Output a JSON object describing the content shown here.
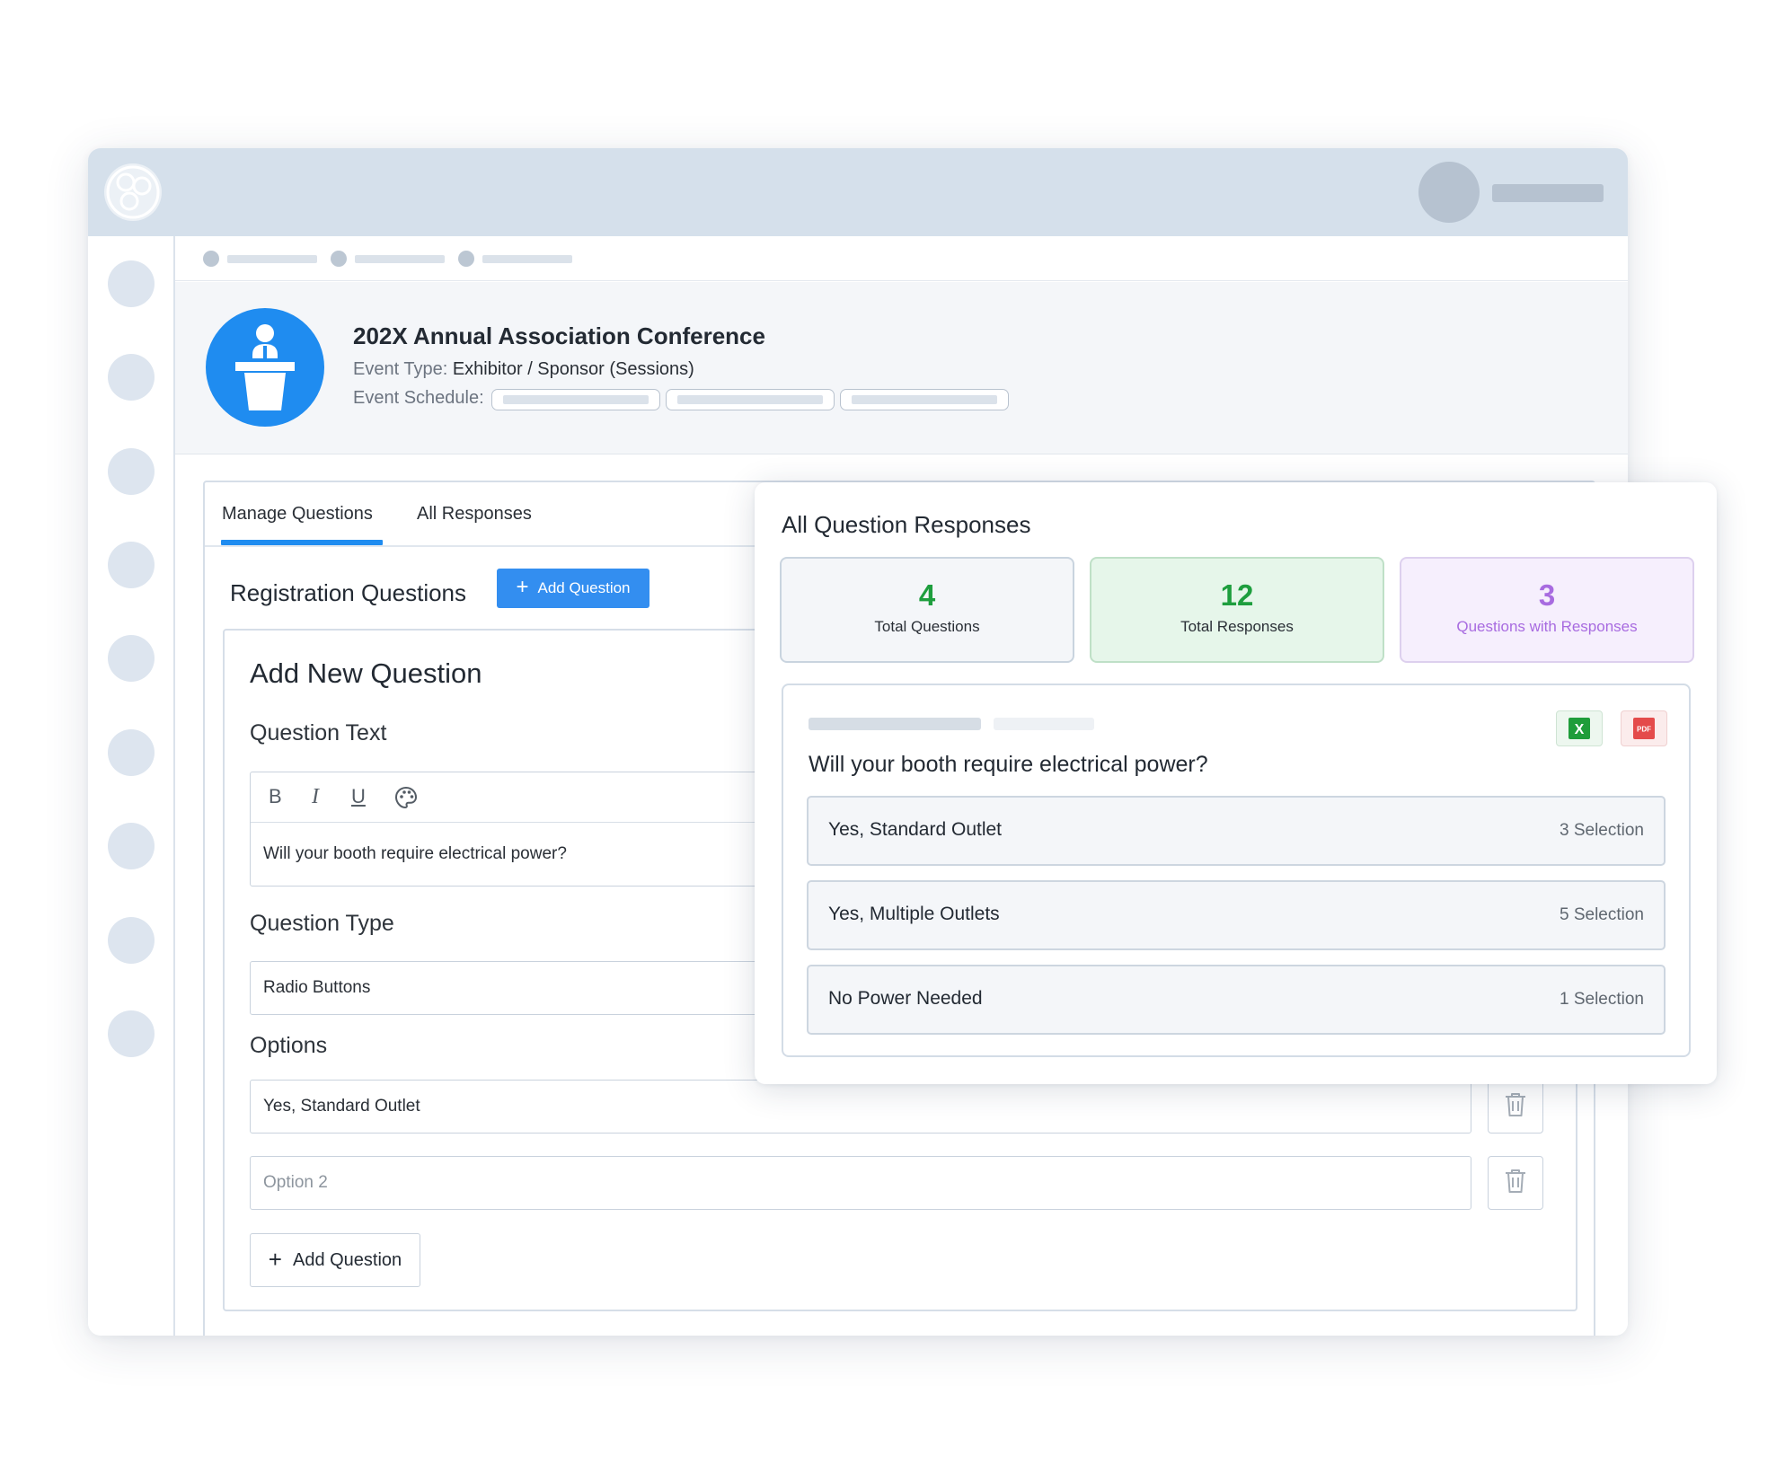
{
  "event": {
    "title": "202X Annual Association Conference",
    "type_label": "Event Type:",
    "type_value": "Exhibitor / Sponsor (Sessions)",
    "schedule_label": "Event Schedule:"
  },
  "tabs": [
    {
      "label": "Manage Questions",
      "active": true
    },
    {
      "label": "All Responses",
      "active": false
    }
  ],
  "registration": {
    "title": "Registration Questions",
    "add_button": "Add Question"
  },
  "form": {
    "heading": "Add New Question",
    "question_text_label": "Question Text",
    "toolbar": {
      "bold": "B",
      "italic": "I",
      "underline": "U"
    },
    "question_text_value": "Will your booth require electrical power?",
    "question_type_label": "Question Type",
    "question_type_value": "Radio Buttons",
    "options_label": "Options",
    "options": [
      {
        "value": "Yes, Standard Outlet",
        "placeholder": ""
      },
      {
        "value": "",
        "placeholder": "Option 2"
      }
    ],
    "add_button": "Add Question"
  },
  "responses": {
    "title": "All Question Responses",
    "stats": [
      {
        "number": "4",
        "label": "Total Questions",
        "color": "#1e9e3e"
      },
      {
        "number": "12",
        "label": "Total Responses",
        "color": "#1e9e3e"
      },
      {
        "number": "3",
        "label": "Questions with Responses",
        "color": "#a86be0"
      }
    ],
    "question": "Will your booth require electrical power?",
    "excel_label": "X",
    "pdf_label": "PDF",
    "options": [
      {
        "name": "Yes, Standard Outlet",
        "count": "3 Selection"
      },
      {
        "name": "Yes, Multiple Outlets",
        "count": "5 Selection"
      },
      {
        "name": "No Power Needed",
        "count": "1 Selection"
      }
    ]
  },
  "colors": {
    "accent": "#1f8cf0",
    "button_primary": "#338ef0",
    "green": "#1e9e3e",
    "purple": "#a86be0"
  }
}
